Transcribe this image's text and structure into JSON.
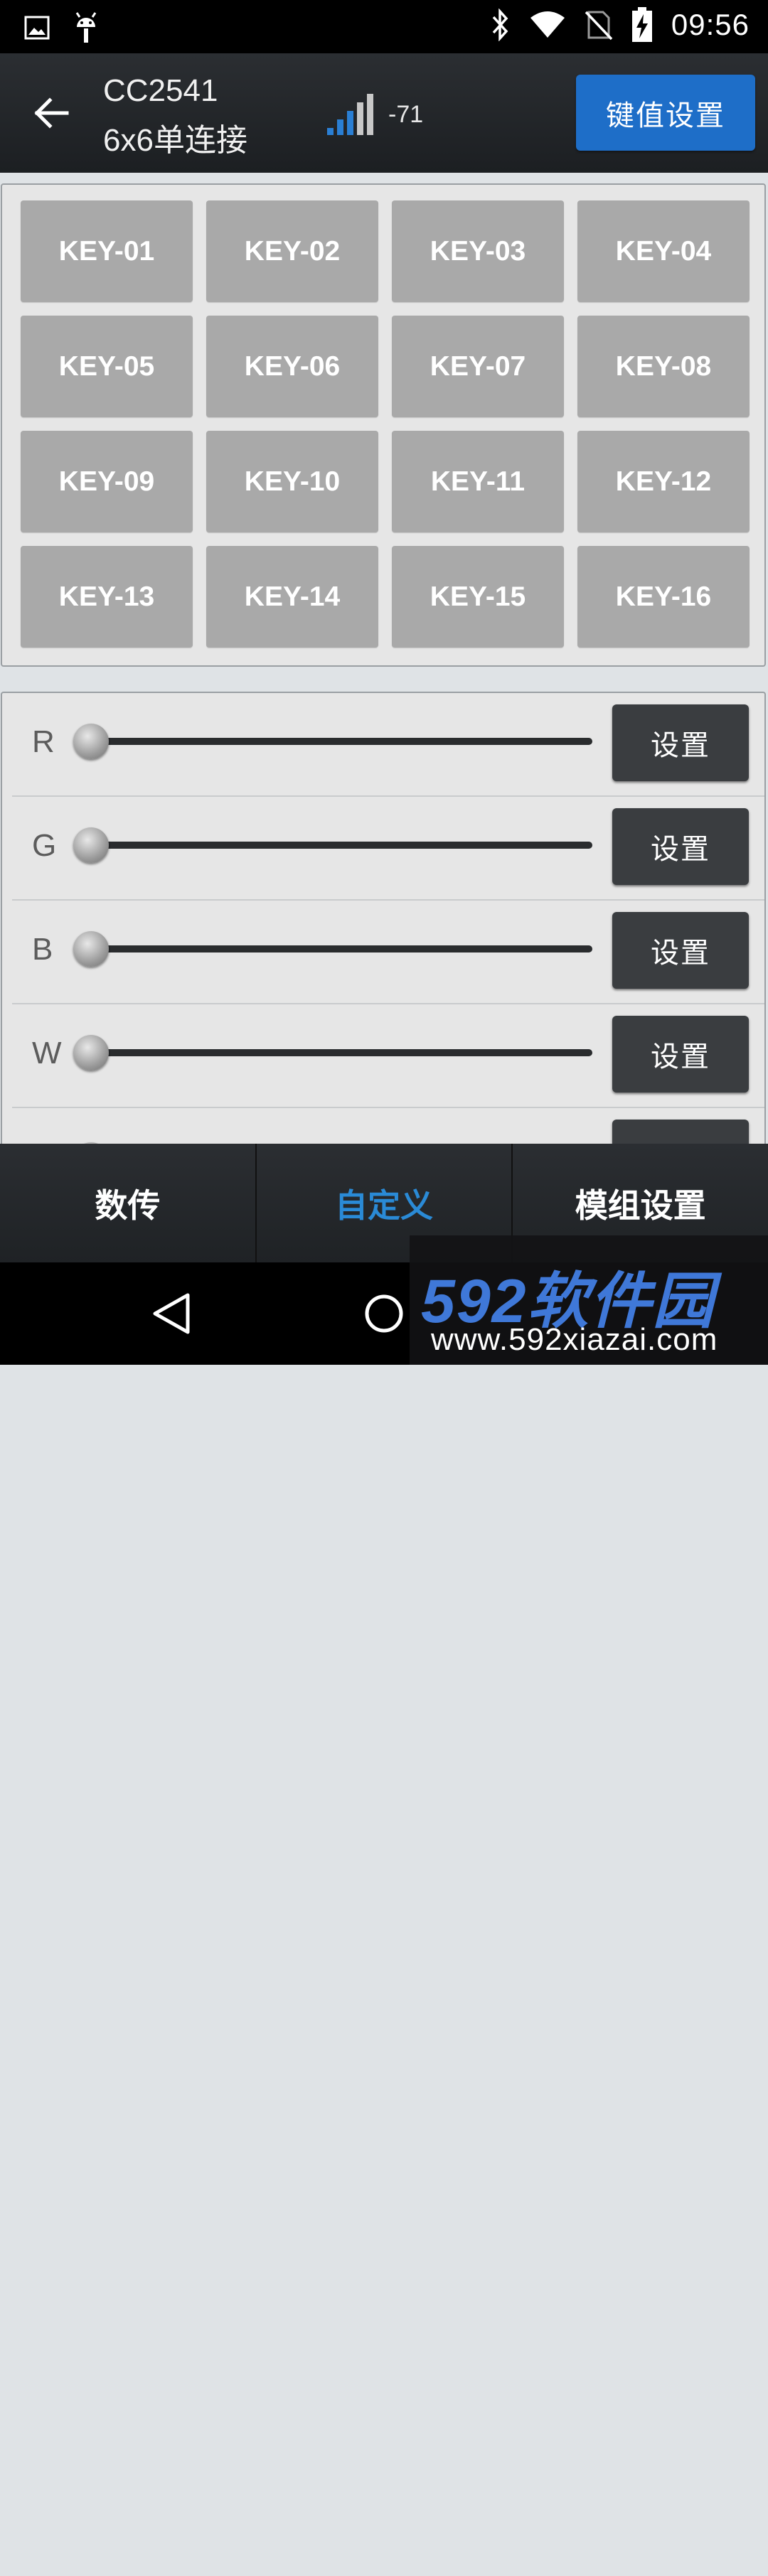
{
  "status_bar": {
    "time": "09:56",
    "icons": [
      "image-icon",
      "android-icon",
      "bluetooth-icon",
      "wifi-icon",
      "no-sim-icon",
      "battery-charging-icon"
    ]
  },
  "app_bar": {
    "device_name": "CC2541",
    "connection_mode": "6x6单连接",
    "rssi": "-71",
    "key_setting_label": "键值设置"
  },
  "keys": [
    "KEY-01",
    "KEY-02",
    "KEY-03",
    "KEY-04",
    "KEY-05",
    "KEY-06",
    "KEY-07",
    "KEY-08",
    "KEY-09",
    "KEY-10",
    "KEY-11",
    "KEY-12",
    "KEY-13",
    "KEY-14",
    "KEY-15",
    "KEY-16"
  ],
  "sliders": [
    {
      "label": "R",
      "value": 0,
      "button": "设置"
    },
    {
      "label": "G",
      "value": 0,
      "button": "设置"
    },
    {
      "label": "B",
      "value": 0,
      "button": "设置"
    },
    {
      "label": "W",
      "value": 0,
      "button": "设置"
    }
  ],
  "tabs": [
    {
      "label": "数传",
      "active": false
    },
    {
      "label": "自定义",
      "active": true
    },
    {
      "label": "模组设置",
      "active": false
    }
  ],
  "watermark": {
    "logo": "592软件园",
    "url": "www.592xiazai.com"
  },
  "colors": {
    "accent": "#1e6ec8",
    "active_tab": "#2a8ad6",
    "key_bg": "#a9a9a9"
  }
}
